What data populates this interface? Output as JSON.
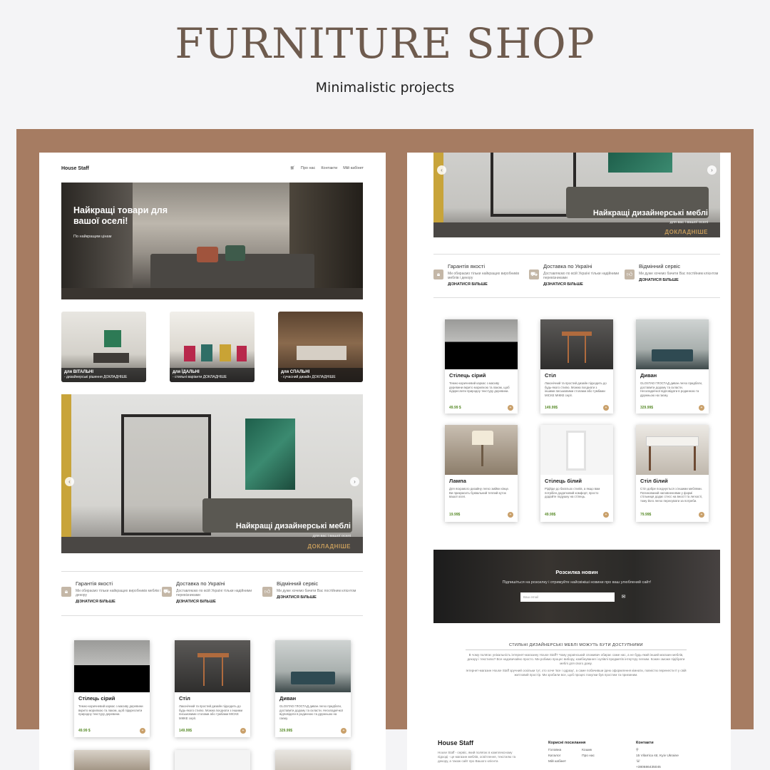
{
  "header": {
    "title": "FURNITURE SHOP",
    "subtitle": "Minimalistic projects"
  },
  "colors": {
    "band": "#a67c62",
    "accent": "#c39a5b",
    "price": "#5a8c2b",
    "brand": "#6e5b4e"
  },
  "site": {
    "logo": "House Staff",
    "cart_icon": "cart-icon",
    "nav": [
      "Про нас",
      "Контакти",
      "Мій кабінет"
    ]
  },
  "hero": {
    "title": "Найкращі товари для вашої оселі!",
    "subtitle": "По найкращим цінам"
  },
  "categories": [
    {
      "name": "для ВІТАЛЬНІ",
      "text": "- дизайнерські рішення",
      "more": "ДОКЛАДНІШЕ"
    },
    {
      "name": "для ЇДАЛЬНІ",
      "text": "- стильні варіанти",
      "more": "ДОКЛАДНІШЕ"
    },
    {
      "name": "для СПАЛЬНІ",
      "text": "- сучасний дизайн",
      "more": "ДОКЛАДНІШЕ"
    }
  ],
  "slider": {
    "title": "Найкращі дизайнерські меблі",
    "subtitle": "для вас і вашої оселі",
    "more": "ДОКЛАДНІШЕ",
    "prev": "‹",
    "next": "›"
  },
  "features": [
    {
      "icon": "lock-icon",
      "title": "Гарантія якості",
      "text": "Ми обираємо тільки найкращих виробників меблів і декору",
      "more": "ДІЗНАТИСЯ БІЛЬШЕ"
    },
    {
      "icon": "truck-icon",
      "title": "Доставка по Україні",
      "text": "Доставляємо по всій Україні тільки надійними перевізниками",
      "more": "ДІЗНАТИСЯ БІЛЬШЕ"
    },
    {
      "icon": "thumbs-up-icon",
      "title": "Відмінний сервіс",
      "text": "Ми дуже хочемо бачити Вас постійним клієнтом",
      "more": "ДІЗНАТИСЯ БІЛЬШЕ"
    }
  ],
  "products": [
    {
      "name": "Стілець сірий",
      "desc": "Темно-коричневий каркас з масиву деревини вкрито морилкою та лаком, щоб підкреслити природну текстуру деревини.",
      "price": "49.99 $"
    },
    {
      "name": "Стіл",
      "desc": "Лаконічний та простий дизайн підходить до будь-якого стилю. Можна поєднати з іншими письмовими столами або тумбами MICKE МІККЕ серії.",
      "price": "149.99$"
    },
    {
      "name": "Диван",
      "desc": "GLOSTAD ГЛОСТАД диван легко придбати, доставити додому та скласти. Нескладнічкої відповідати в родинною та дружньою на гаєму.",
      "price": "329.99$"
    },
    {
      "name": "Лампа",
      "desc": "Для яскравого дизайну легко змійки кінце. Ви прикрасить буквальний теплий куток вашої осел.",
      "price": "19.99$"
    },
    {
      "name": "Стілець білий",
      "desc": "Рідійде до багатьох стилів, а якщо вам потрібен додатковий комфорт, просто додайте подушку на стілець.",
      "price": "49.99$"
    },
    {
      "name": "Стіл білий",
      "desc": "Стіл добре поєднується з іншими меблями. Патинований наповненнями у формі стільниця додає стесс на вності та легкості, тому його легко пересувати за потреби.",
      "price": "79.99$"
    }
  ],
  "newsletter": {
    "title": "Розсилка новин",
    "text": "Підпишіться на розсилку і отримуйте найсвіжіші новини про ваш улюблений сайт!",
    "placeholder": "Ваш email",
    "button_icon": "mail-icon"
  },
  "about": {
    "title": "СТИЛЬНІ ДИЗАЙНЕРСЬКІ МЕБЛІ МОЖУТЬ БУТИ ДОСТУПНИМИ",
    "p1": "В чому полягає унікальність інтернет-магазину House Staff? Чому український споживач обирає саме нас, а не будь-який інший магазин меблів, декору і текстилю? Все надзвичайно просто. Ми робимо процес вибору, комбінування і купівлі предметів інтер'єру легким. Кожен зможе підібрати меблі для свого дому.",
    "p2": "Інтернет-магазин House Staff зручний оскільки тут, хто хоче 'все і одразу', а саме побачивши ідею оформлення кімнати, повністю перенести її у свій житловий простір. Ми зробили все, щоб процес покупки був простим та приємним."
  },
  "footer": {
    "logo": "House Staff",
    "desc": "House Staff - сервіс, який полягає в комплексному підході - це магазин меблів, освітлення, текстилю та декору, а також сайт про Вашого клієнта",
    "links_title": "Корисні посилання",
    "links": [
      "Головна",
      "Каталог",
      "Мій кабінет",
      "Кошик",
      "Про нас"
    ],
    "contacts_title": "Контакти",
    "address": "15 Vilarrica str, Kyiv Ukraine",
    "phone": "+380686435045"
  }
}
